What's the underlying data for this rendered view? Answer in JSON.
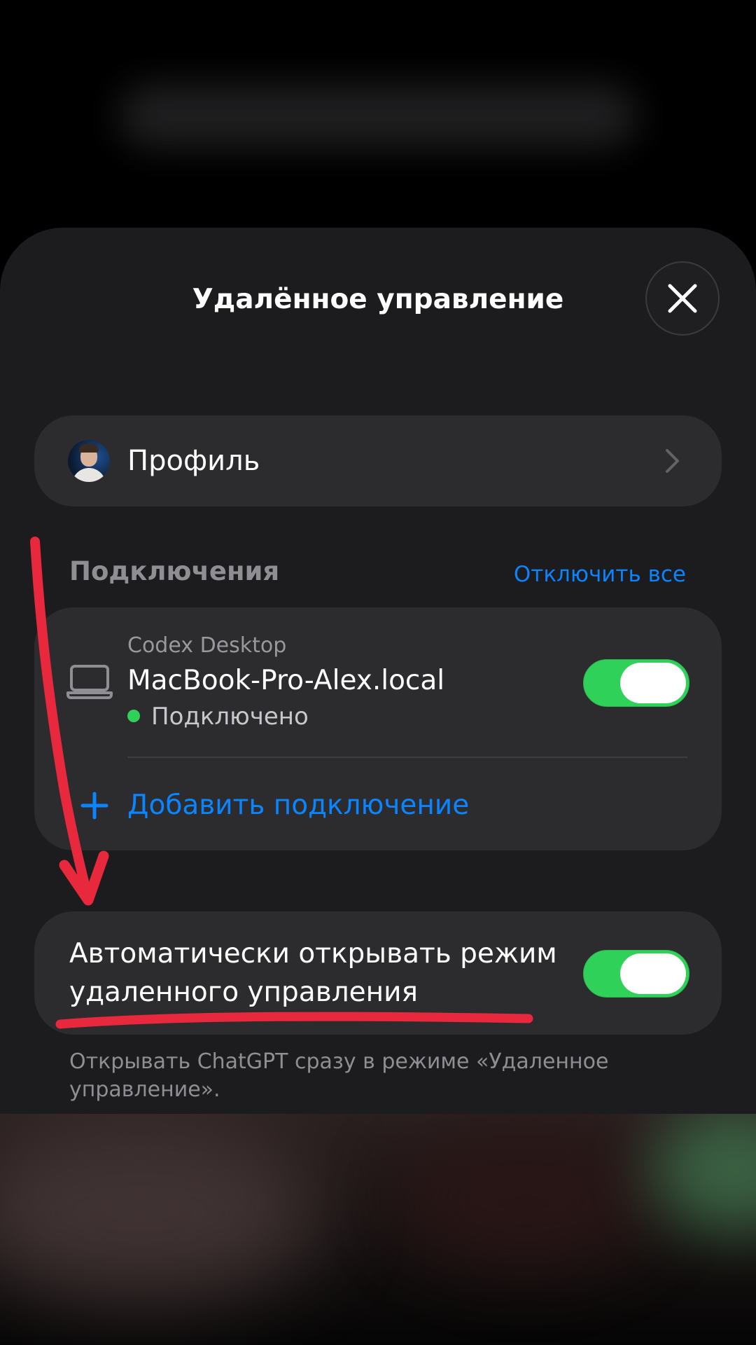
{
  "sheet": {
    "title": "Удалённое управление",
    "close_icon": "close-icon"
  },
  "profile": {
    "label": "Профиль",
    "chevron_icon": "chevron-right-icon"
  },
  "connections": {
    "title": "Подключения",
    "disconnect_all": "Отключить все",
    "items": [
      {
        "app": "Codex Desktop",
        "device": "MacBook-Pro-Alex.local",
        "status": "Подключено",
        "enabled": true,
        "icon": "laptop-icon"
      }
    ],
    "add_label": "Добавить подключение"
  },
  "auto_open": {
    "label": "Автоматически открывать режим удаленного управления",
    "enabled": true,
    "note": "Открывать ChatGPT сразу в режиме «Удаленное управление»."
  },
  "colors": {
    "sheet_bg": "#1c1c1e",
    "card_bg": "#2c2c2e",
    "accent_blue": "#0a84ff",
    "toggle_green": "#30d158",
    "annotation_red": "#e8283c"
  }
}
